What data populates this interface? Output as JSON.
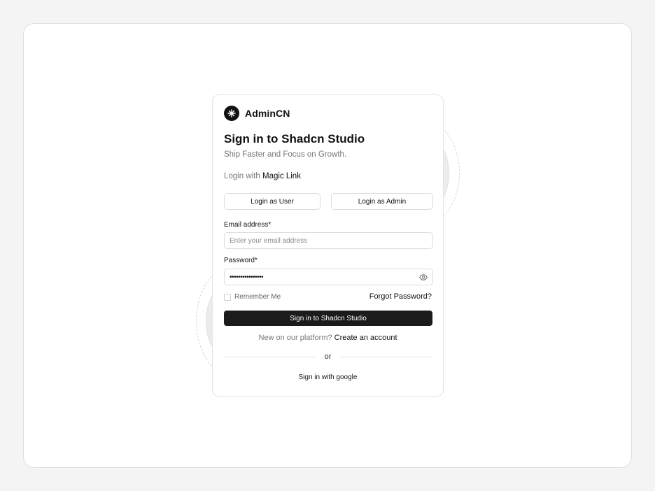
{
  "brand": {
    "name": "AdminCN",
    "logo_icon": "asterisk-icon"
  },
  "heading": {
    "title": "Sign in to Shadcn Studio",
    "subtitle": "Ship Faster and Focus on Growth."
  },
  "magic_link": {
    "prefix": "Login with ",
    "link": "Magic Link"
  },
  "quick_login": {
    "user_label": "Login as User",
    "admin_label": "Login as Admin"
  },
  "form": {
    "email_label": "Email address*",
    "email_placeholder": "Enter your email address",
    "email_value": "",
    "password_label": "Password*",
    "password_value": "••••••••••••••••",
    "remember_label": "Remember Me",
    "remember_checked": false,
    "forgot_label": "Forgot Password?",
    "submit_label": "Sign in to Shadcn Studio"
  },
  "signup": {
    "prefix": "New on our platform? ",
    "link": "Create an account"
  },
  "divider_text": "or",
  "google_label": "Sign in with google",
  "colors": {
    "primary": "#1b1b1b",
    "background": "#f4f4f4",
    "card": "#ffffff",
    "muted_text": "#777777"
  }
}
